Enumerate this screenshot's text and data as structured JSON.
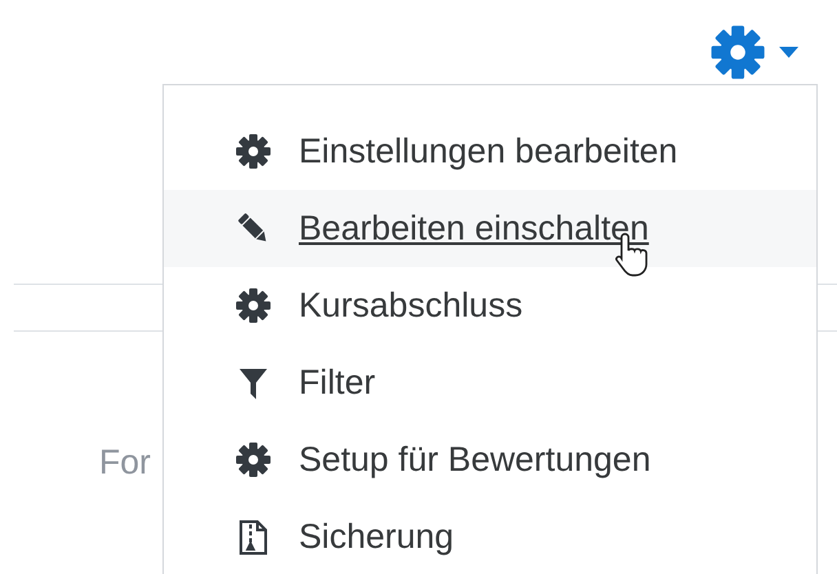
{
  "page": {
    "partial_text": "For"
  },
  "settings_menu": {
    "items": [
      {
        "label": "Einstellungen bearbeiten",
        "kind": "gear",
        "selected": false
      },
      {
        "label": "Bearbeiten einschalten",
        "kind": "pencil",
        "selected": true
      },
      {
        "label": "Kursabschluss",
        "kind": "gear",
        "selected": false
      },
      {
        "label": "Filter",
        "kind": "filter",
        "selected": false
      },
      {
        "label": "Setup für Bewertungen",
        "kind": "gear",
        "selected": false
      },
      {
        "label": "Sicherung",
        "kind": "archive",
        "selected": false
      }
    ]
  }
}
